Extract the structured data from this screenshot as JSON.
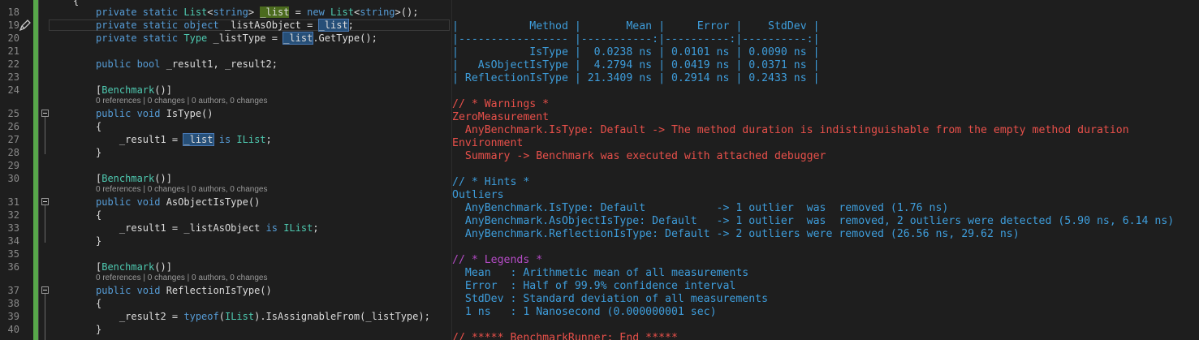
{
  "editor": {
    "line_numbers": [
      "18",
      "19",
      "20",
      "21",
      "22",
      "23",
      "24",
      "25",
      "26",
      "27",
      "28",
      "29",
      "30",
      "31",
      "32",
      "33",
      "34",
      "35",
      "36",
      "37",
      "38",
      "39",
      "40"
    ],
    "lines": {
      "l18_a": "private static ",
      "l18_b": "List",
      "l18_c": "<",
      "l18_d": "string",
      "l18_e": "> ",
      "l18_f": "_list",
      "l18_g": " = ",
      "l18_h": "new ",
      "l18_i": "List",
      "l18_j": "<",
      "l18_k": "string",
      "l18_l": ">();",
      "l19_a": "private static object",
      "l19_b": " _listAsObject = ",
      "l19_c": "_list",
      "l19_d": ";",
      "l20_a": "private static ",
      "l20_b": "Type",
      "l20_c": " _listType = ",
      "l20_d": "_list",
      "l20_e": ".GetType();",
      "l22_a": "public bool",
      "l22_b": " _result1, _result2;",
      "l24_a": "[",
      "l24_b": "Benchmark",
      "l24_c": "()]",
      "l25_a": "public void",
      "l25_b": " IsType()",
      "l26": "{",
      "l27_a": "    _result1 = ",
      "l27_b": "_list",
      "l27_c": " is ",
      "l27_d": "IList",
      "l27_e": ";",
      "l28": "}",
      "l30_a": "[",
      "l30_b": "Benchmark",
      "l30_c": "()]",
      "l31_a": "public void",
      "l31_b": " AsObjectIsType()",
      "l32": "{",
      "l33_a": "    _result1 = _listAsObject ",
      "l33_b": "is",
      "l33_c": " ",
      "l33_d": "IList",
      "l33_e": ";",
      "l34": "}",
      "l36_a": "[",
      "l36_b": "Benchmark",
      "l36_c": "()]",
      "l37_a": "public void",
      "l37_b": " ReflectionIsType()",
      "l38": "{",
      "l39_a": "    _result2 = ",
      "l39_b": "typeof",
      "l39_c": "(",
      "l39_d": "IList",
      "l39_e": ").IsAssignableFrom(_listType);",
      "l40": "}"
    },
    "codelens": "0 references | 0 changes | 0 authors, 0 changes",
    "top_brace": "{"
  },
  "console": {
    "table": [
      "|           Method |       Mean |     Error |    StdDev |",
      "|----------------- |-----------:|----------:|----------:|",
      "|           IsType |  0.0238 ns | 0.0101 ns | 0.0090 ns |",
      "|   AsObjectIsType |  4.2794 ns | 0.0419 ns | 0.0371 ns |",
      "| ReflectionIsType | 21.3409 ns | 0.2914 ns | 0.2433 ns |"
    ],
    "warnings": [
      "// * Warnings *",
      "ZeroMeasurement",
      "  AnyBenchmark.IsType: Default -> The method duration is indistinguishable from the empty method duration",
      "Environment",
      "  Summary -> Benchmark was executed with attached debugger"
    ],
    "hints": [
      "// * Hints *",
      "Outliers",
      "  AnyBenchmark.IsType: Default           -> 1 outlier  was  removed (1.76 ns)",
      "  AnyBenchmark.AsObjectIsType: Default   -> 1 outlier  was  removed, 2 outliers were detected (5.90 ns, 6.14 ns)",
      "  AnyBenchmark.ReflectionIsType: Default -> 2 outliers were removed (26.56 ns, 29.62 ns)"
    ],
    "legends_header": "// * Legends *",
    "legends": [
      "  Mean   : Arithmetic mean of all measurements",
      "  Error  : Half of 99.9% confidence interval",
      "  StdDev : Standard deviation of all measurements",
      "  1 ns   : 1 Nanosecond (0.000000001 sec)"
    ],
    "footer": "// ***** BenchmarkRunner: End *****"
  },
  "colors": {
    "keyword": "#569cd6",
    "type": "#4ec9b0",
    "table": "#3e9ddb",
    "warning": "#e8504a",
    "legend": "#b44bc5",
    "change_margin": "#57a64a"
  },
  "icons": {
    "edit": "pencil-edit-icon",
    "fold": "collapse-toggle-icon"
  }
}
